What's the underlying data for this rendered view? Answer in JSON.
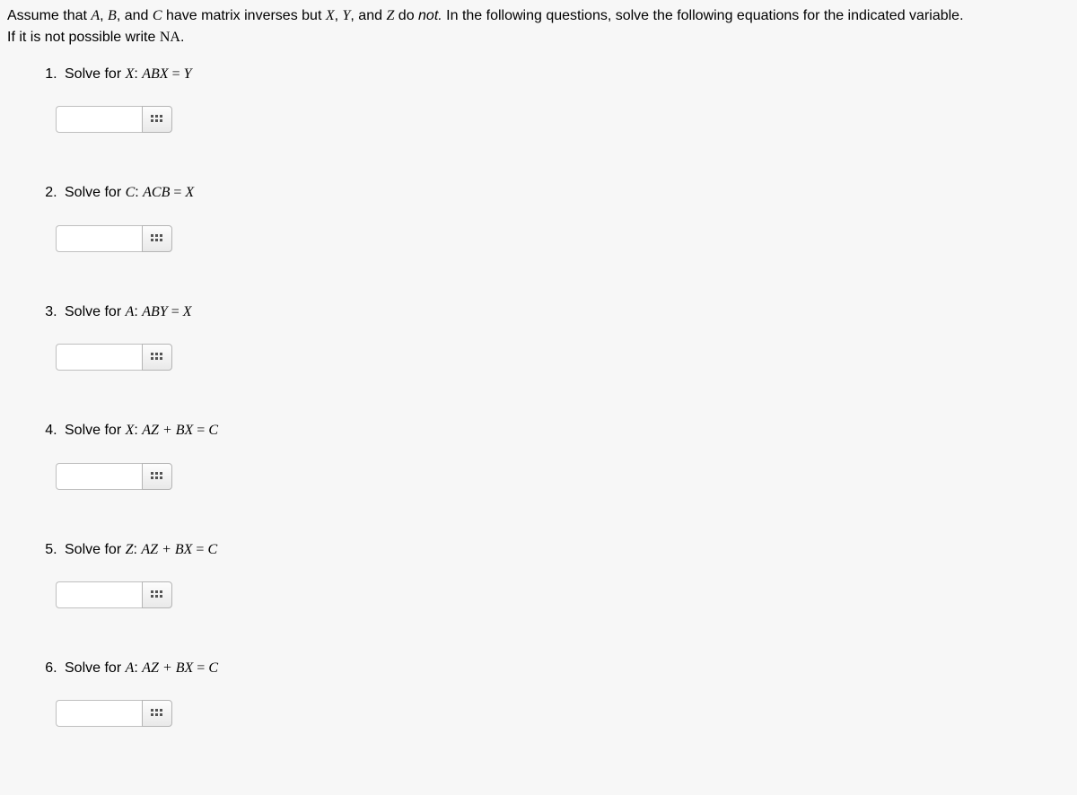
{
  "intro": {
    "p1a": "Assume that ",
    "v1": "A",
    "p1b": ", ",
    "v2": "B",
    "p1c": ", and ",
    "v3": "C",
    "p1d": " have matrix inverses but ",
    "v4": "X",
    "p1e": ", ",
    "v5": "Y",
    "p1f": ", and ",
    "v6": "Z",
    "p1g": " do ",
    "not": "not.",
    "p1h": " In the following questions, solve the following equations for the indicated variable.",
    "line2a": "If it is not possible write ",
    "na": "NA",
    "period": "."
  },
  "questions": [
    {
      "lead": "Solve for ",
      "tv": "X",
      "colon": ": ",
      "lhs": "ABX",
      "eq": " = ",
      "rhs": "Y"
    },
    {
      "lead": "Solve for ",
      "tv": "C",
      "colon": ": ",
      "lhs": "ACB",
      "eq": " = ",
      "rhs": "X"
    },
    {
      "lead": "Solve for ",
      "tv": "A",
      "colon": ": ",
      "lhs": "ABY",
      "eq": " = ",
      "rhs": "X"
    },
    {
      "lead": "Solve for ",
      "tv": "X",
      "colon": ": ",
      "lhs": "AZ + BX",
      "eq": " = ",
      "rhs": "C"
    },
    {
      "lead": "Solve for ",
      "tv": "Z",
      "colon": ": ",
      "lhs": "AZ + BX",
      "eq": " = ",
      "rhs": "C"
    },
    {
      "lead": "Solve for ",
      "tv": "A",
      "colon": ": ",
      "lhs": "AZ + BX",
      "eq": " = ",
      "rhs": "C"
    }
  ],
  "input_value": "",
  "input_placeholder": ""
}
